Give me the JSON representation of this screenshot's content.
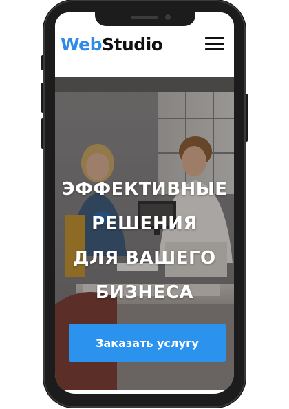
{
  "header": {
    "logo_part1": "Web",
    "logo_part2": "Studio",
    "menu_icon": "hamburger-menu-icon"
  },
  "hero": {
    "title_lines": [
      "ЭФФЕКТИВНЫЕ",
      "РЕШЕНИЯ",
      "ДЛЯ ВАШЕГО",
      "БИЗНЕСА"
    ],
    "cta_label": "Заказать услугу"
  },
  "colors": {
    "brand_blue": "#2f8ae8",
    "cta_blue": "#2b93ee",
    "text_dark": "#111111",
    "phone_frame": "#1c1c1c"
  }
}
